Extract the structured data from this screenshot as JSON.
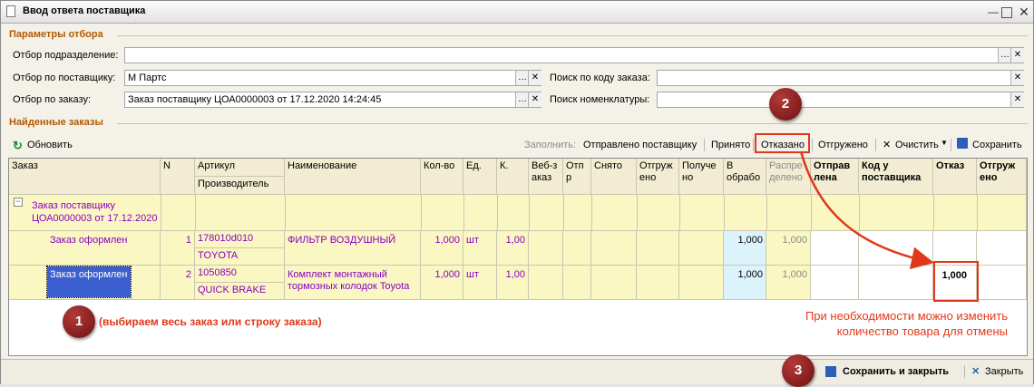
{
  "window": {
    "title": "Ввод ответа поставщика"
  },
  "filters": {
    "section_title": "Параметры отбора",
    "subdivision_label": "Отбор подразделение:",
    "subdivision_value": "",
    "supplier_label": "Отбор по поставщику:",
    "supplier_value": "М Партс",
    "order_label": "Отбор по заказу:",
    "order_value": "Заказ поставщику ЦОА0000003 от 17.12.2020 14:24:45",
    "order_code_search_label": "Поиск по коду заказа:",
    "order_code_search_value": "",
    "nomenclature_search_label": "Поиск номенклатуры:",
    "nomenclature_search_value": ""
  },
  "found": {
    "section_title": "Найденные заказы"
  },
  "toolbar": {
    "refresh": "Обновить",
    "fill_label": "Заполнить:",
    "sent": "Отправлено поставщику",
    "accepted": "Принято",
    "refused": "Отказано",
    "shipped": "Отгружено",
    "clear": "Очистить",
    "save": "Сохранить"
  },
  "table": {
    "headers": {
      "order": "Заказ",
      "n": "N",
      "article": "Артикул",
      "manufacturer": "Производитель",
      "name": "Наименование",
      "qty": "Кол-во",
      "unit": "Ед.",
      "k": "К.",
      "web": "Веб-з\nаказ",
      "otp": "Отп\nр",
      "removed": "Снято",
      "shipped": "Отгруж\nено",
      "received": "Получе\nно",
      "in_processing": "В\nобрабо",
      "distributed": "Распре\nделено",
      "sent": "Отправ\nлена",
      "supplier_code": "Код у\nпоставщика",
      "refusal": "Отказ",
      "shipped_bold": "Отгруж\nено"
    },
    "group": {
      "title": "Заказ поставщику ЦОА0000003 от 17.12.2020"
    },
    "rows": [
      {
        "status": "Заказ оформлен",
        "n": "1",
        "article": "178010d010",
        "manufacturer": "TOYOTA",
        "name": "ФИЛЬТР ВОЗДУШНЫЙ",
        "qty": "1,000",
        "unit": "шт",
        "k": "1,00",
        "in_processing": "1,000",
        "distributed": "1,000",
        "refusal": ""
      },
      {
        "status": "Заказ оформлен",
        "n": "2",
        "article": "1050850",
        "manufacturer": "QUICK BRAKE",
        "name": "Комплект монтажный тормозных колодок Toyota",
        "qty": "1,000",
        "unit": "шт",
        "k": "1,00",
        "in_processing": "1,000",
        "distributed": "1,000",
        "refusal": "1,000"
      }
    ]
  },
  "annotations": {
    "badge1": "1",
    "badge2": "2",
    "badge3": "3",
    "note1": "(выбираем весь заказ или строку заказа)",
    "note2_line1": "При необходимости можно изменить",
    "note2_line2": "количество товара для отмены"
  },
  "footer": {
    "save_close": "Сохранить и закрыть",
    "close": "Закрыть"
  },
  "colors": {
    "accent_red": "#e0391a",
    "badge_red": "#8b1a1a",
    "selection_blue": "#3b5fcf"
  }
}
